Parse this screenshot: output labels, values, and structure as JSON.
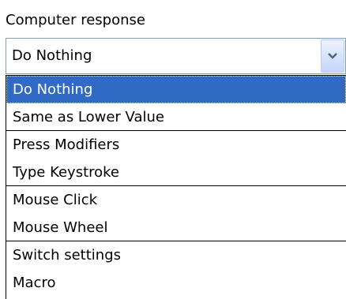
{
  "field": {
    "label": "Computer response",
    "selected_value": "Do Nothing",
    "dropdown_icon": "chevron-down-icon",
    "accent_color": "#316ac5"
  },
  "options": [
    {
      "label": "Do Nothing",
      "selected": true,
      "separator_after": false
    },
    {
      "label": "Same as Lower Value",
      "selected": false,
      "separator_after": true
    },
    {
      "label": "Press Modifiers",
      "selected": false,
      "separator_after": false
    },
    {
      "label": "Type Keystroke",
      "selected": false,
      "separator_after": true
    },
    {
      "label": "Mouse Click",
      "selected": false,
      "separator_after": false
    },
    {
      "label": "Mouse Wheel",
      "selected": false,
      "separator_after": true
    },
    {
      "label": "Switch settings",
      "selected": false,
      "separator_after": false
    },
    {
      "label": "Macro",
      "selected": false,
      "separator_after": false
    }
  ]
}
